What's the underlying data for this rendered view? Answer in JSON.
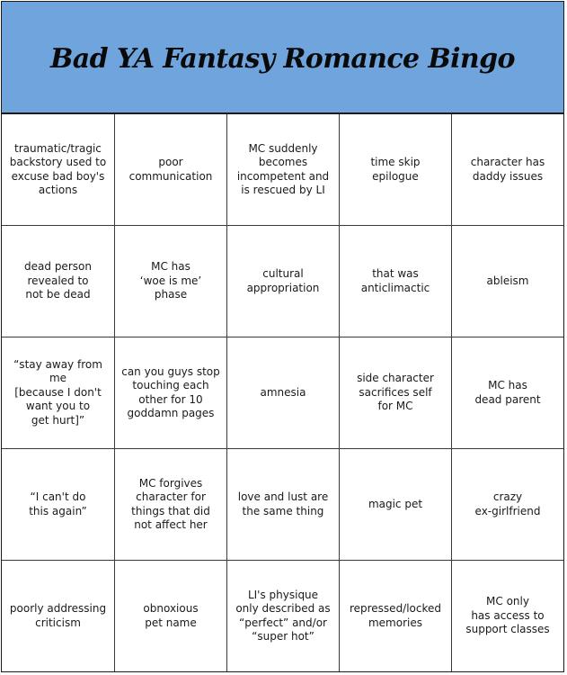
{
  "title": "Bad YA Fantasy Romance Bingo",
  "colors": {
    "header_background": "#6fa4dc",
    "grid_lines": "#3a3a3a",
    "text": "#1a1a1a"
  },
  "cells": [
    "traumatic/tragic\nbackstory used to\nexcuse bad boy's\nactions",
    "poor\ncommunication",
    "MC suddenly\nbecomes\nincompetent and\nis rescued by LI",
    "time skip\nepilogue",
    "character has\ndaddy issues",
    "dead person\nrevealed to\nnot be dead",
    "MC has\n‘woe is me’\nphase",
    "cultural\nappropriation",
    "that was\nanticlimactic",
    "ableism",
    "“stay away from me\n[because I don't\nwant you to\nget hurt]”",
    "can you guys stop\ntouching each\nother for 10\ngoddamn pages",
    "amnesia",
    "side character\nsacrifices self\nfor MC",
    "MC has\ndead parent",
    "“I can't do\nthis again”",
    "MC forgives\ncharacter for\nthings that did\nnot affect her",
    "love and lust are\nthe same thing",
    "magic pet",
    "crazy\nex-girlfriend",
    "poorly addressing\ncriticism",
    "obnoxious\npet name",
    "LI's physique\nonly described as\n“perfect” and/or\n“super hot”",
    "repressed/locked\nmemories",
    "MC only\nhas access to\nsupport classes"
  ]
}
